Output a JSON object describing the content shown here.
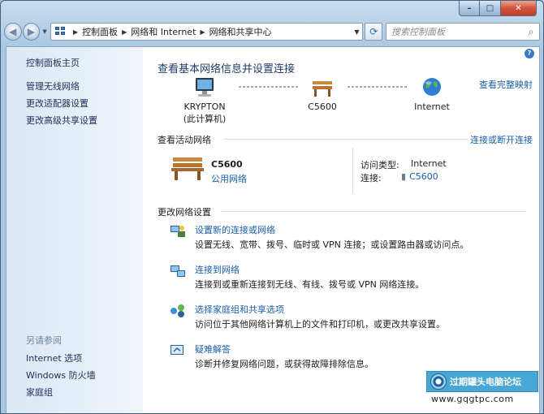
{
  "window": {
    "caption": {
      "minimize": "–",
      "maximize": "□",
      "close": "✕"
    }
  },
  "nav": {
    "back_glyph": "◀",
    "forward_glyph": "▶",
    "breadcrumb": [
      "控制面板",
      "网络和 Internet",
      "网络和共享中心"
    ],
    "breadcrumb_sep": "▶",
    "refresh_glyph": "⟳",
    "search_placeholder": "搜索控制面板",
    "search_glyph": "⌕"
  },
  "sidebar": {
    "home": "控制面板主页",
    "links": [
      "管理无线网络",
      "更改适配器设置",
      "更改高级共享设置"
    ],
    "see_also_title": "另请参阅",
    "see_also": [
      "Internet 选项",
      "Windows 防火墙",
      "家庭组"
    ]
  },
  "main": {
    "help": "?",
    "title": "查看基本网络信息并设置连接",
    "view_full_map": "查看完整映射",
    "map": {
      "computer_name": "KRYPTON",
      "computer_sub": "(此计算机)",
      "network_name": "C5600",
      "internet_name": "Internet"
    },
    "active": {
      "label": "查看活动网络",
      "connect_link": "连接或断开连接",
      "network_name": "C5600",
      "network_type": "公用网络",
      "access_label": "访问类型:",
      "access_value": "Internet",
      "conn_label": "连接:",
      "conn_value": "C5600"
    },
    "change": {
      "label": "更改网络设置",
      "tasks": [
        {
          "link": "设置新的连接或网络",
          "desc": "设置无线、宽带、拨号、临时或 VPN 连接；或设置路由器或访问点。",
          "icon": "new-connection-icon"
        },
        {
          "link": "连接到网络",
          "desc": "连接到或重新连接到无线、有线、拨号或 VPN 网络连接。",
          "icon": "connect-network-icon"
        },
        {
          "link": "选择家庭组和共享选项",
          "desc": "访问位于其他网络计算机上的文件和打印机，或更改共享设置。",
          "icon": "homegroup-icon"
        },
        {
          "link": "疑难解答",
          "desc": "诊断并修复网络问题，或获得故障排除信息。",
          "icon": "troubleshoot-icon"
        }
      ]
    }
  },
  "watermark": {
    "title": "过期罐头电脑论坛",
    "url": "www.gqgtpc.com"
  },
  "colors": {
    "link": "#1a5ea8",
    "title": "#1f3d6b",
    "sidebar": "#dce8f6"
  }
}
